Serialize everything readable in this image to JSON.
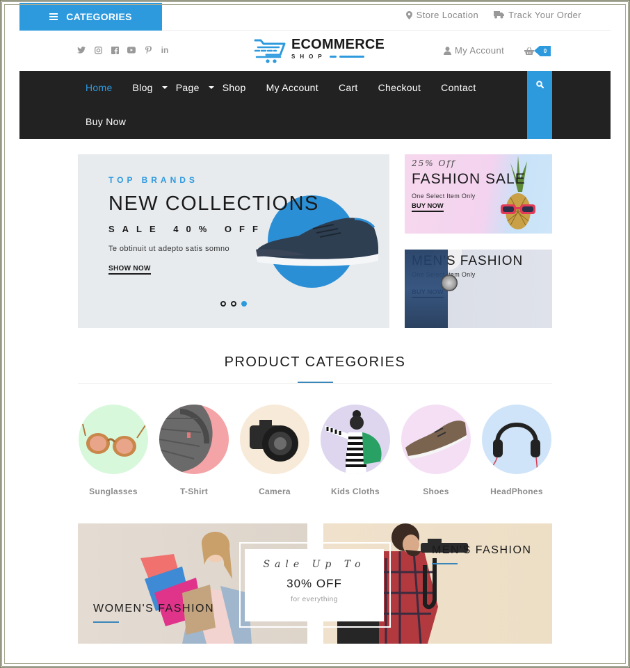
{
  "topbar": {
    "categories_label": "CATEGORIES",
    "links": [
      {
        "icon": "map-marker-icon",
        "label": "Store Location"
      },
      {
        "icon": "truck-icon",
        "label": "Track Your Order"
      }
    ]
  },
  "header": {
    "socials": [
      "twitter-icon",
      "instagram-icon",
      "facebook-icon",
      "youtube-icon",
      "pinterest-icon",
      "linkedin-icon"
    ],
    "logo": {
      "title": "ECOMMERCE",
      "subtitle": "SHOP"
    },
    "account_label": "My Account",
    "cart_count": "0"
  },
  "nav": {
    "items": [
      {
        "label": "Home",
        "active": true
      },
      {
        "label": "Blog",
        "has_dropdown": true
      },
      {
        "label": "Page",
        "has_dropdown": true
      },
      {
        "label": "Shop"
      },
      {
        "label": "My Account"
      },
      {
        "label": "Cart"
      },
      {
        "label": "Checkout"
      },
      {
        "label": "Contact"
      },
      {
        "label": "Buy Now"
      }
    ],
    "search_icon": "search-icon"
  },
  "hero": {
    "kicker": "TOP BRANDS",
    "title": "NEW COLLECTIONS",
    "sale": "SALE 40% OFF",
    "description": "Te obtinuit ut adepto satis somno",
    "button": "SHOW NOW",
    "slides_total": 3,
    "active_slide": 3
  },
  "promos": [
    {
      "kicker": "25% Off",
      "title": "FASHION SALE",
      "subtitle": "One Select Item Only",
      "button": "BUY NOW"
    },
    {
      "title": "MEN'S FASHION",
      "subtitle": "One Select Item Only",
      "button": "BUY NOW"
    }
  ],
  "product_categories": {
    "title": "PRODUCT CATEGORIES",
    "items": [
      {
        "label": "Sunglasses",
        "bg": "#d8f8dc"
      },
      {
        "label": "T-Shirt",
        "bg": "#f4a3a6"
      },
      {
        "label": "Camera",
        "bg": "#f7ead8"
      },
      {
        "label": "Kids Cloths",
        "bg": "#ddd6ee"
      },
      {
        "label": "Shoes",
        "bg": "#f4dff5"
      },
      {
        "label": "HeadPhones",
        "bg": "#cfe4f8"
      }
    ]
  },
  "bottom_banners": {
    "left_title": "WOMEN'S FASHION",
    "right_title": "MEN'S FASHION",
    "sale": {
      "kicker": "Sale Up To",
      "headline": "30% OFF",
      "note": "for everything"
    }
  },
  "colors": {
    "accent": "#2e9ade",
    "nav_bg": "#222222",
    "text_dark": "#1a1a1a",
    "muted": "#888888"
  }
}
